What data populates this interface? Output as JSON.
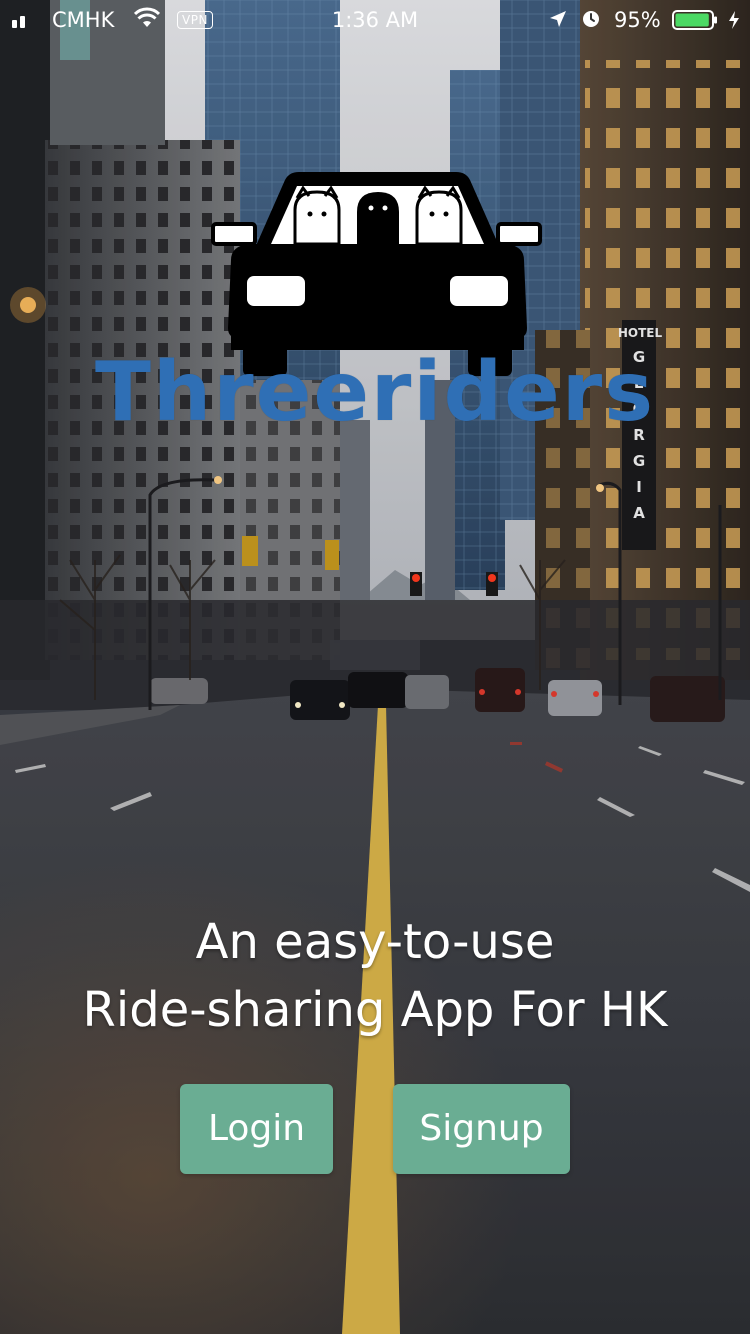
{
  "status_bar": {
    "carrier": "CMHK",
    "vpn": "VPN",
    "time": "1:36 AM",
    "battery_percent": "95%",
    "battery_level": 0.95,
    "icons": [
      "signal-icon",
      "wifi-icon",
      "location-icon",
      "alarm-icon",
      "battery-icon",
      "charging-icon"
    ]
  },
  "logo": {
    "title": "Threeriders",
    "icon": "car-with-three-riders-icon",
    "title_color": "#2f6fb5"
  },
  "tagline": {
    "line1": "An easy-to-use",
    "line2": "Ride-sharing App For HK"
  },
  "actions": {
    "login_label": "Login",
    "signup_label": "Signup",
    "button_color": "#6aad93"
  }
}
